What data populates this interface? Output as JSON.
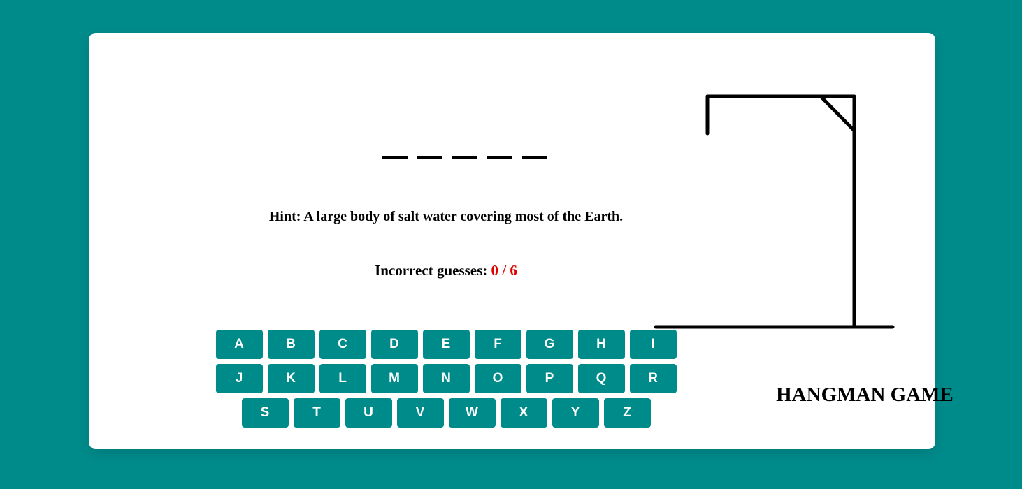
{
  "word": {
    "letters": [
      "",
      "",
      "",
      "",
      ""
    ]
  },
  "hint": {
    "text": "Hint: A large body of salt water covering most of the Earth."
  },
  "guesses": {
    "label": "Incorrect guesses:",
    "count": "0 / 6"
  },
  "keyboard": {
    "keys": [
      "A",
      "B",
      "C",
      "D",
      "E",
      "F",
      "G",
      "H",
      "I",
      "J",
      "K",
      "L",
      "M",
      "N",
      "O",
      "P",
      "Q",
      "R",
      "S",
      "T",
      "U",
      "V",
      "W",
      "X",
      "Y",
      "Z"
    ]
  },
  "game": {
    "title": "HANGMAN GAME"
  },
  "colors": {
    "background": "#008b8b",
    "key": "#008b8b",
    "count": "#e00000"
  }
}
